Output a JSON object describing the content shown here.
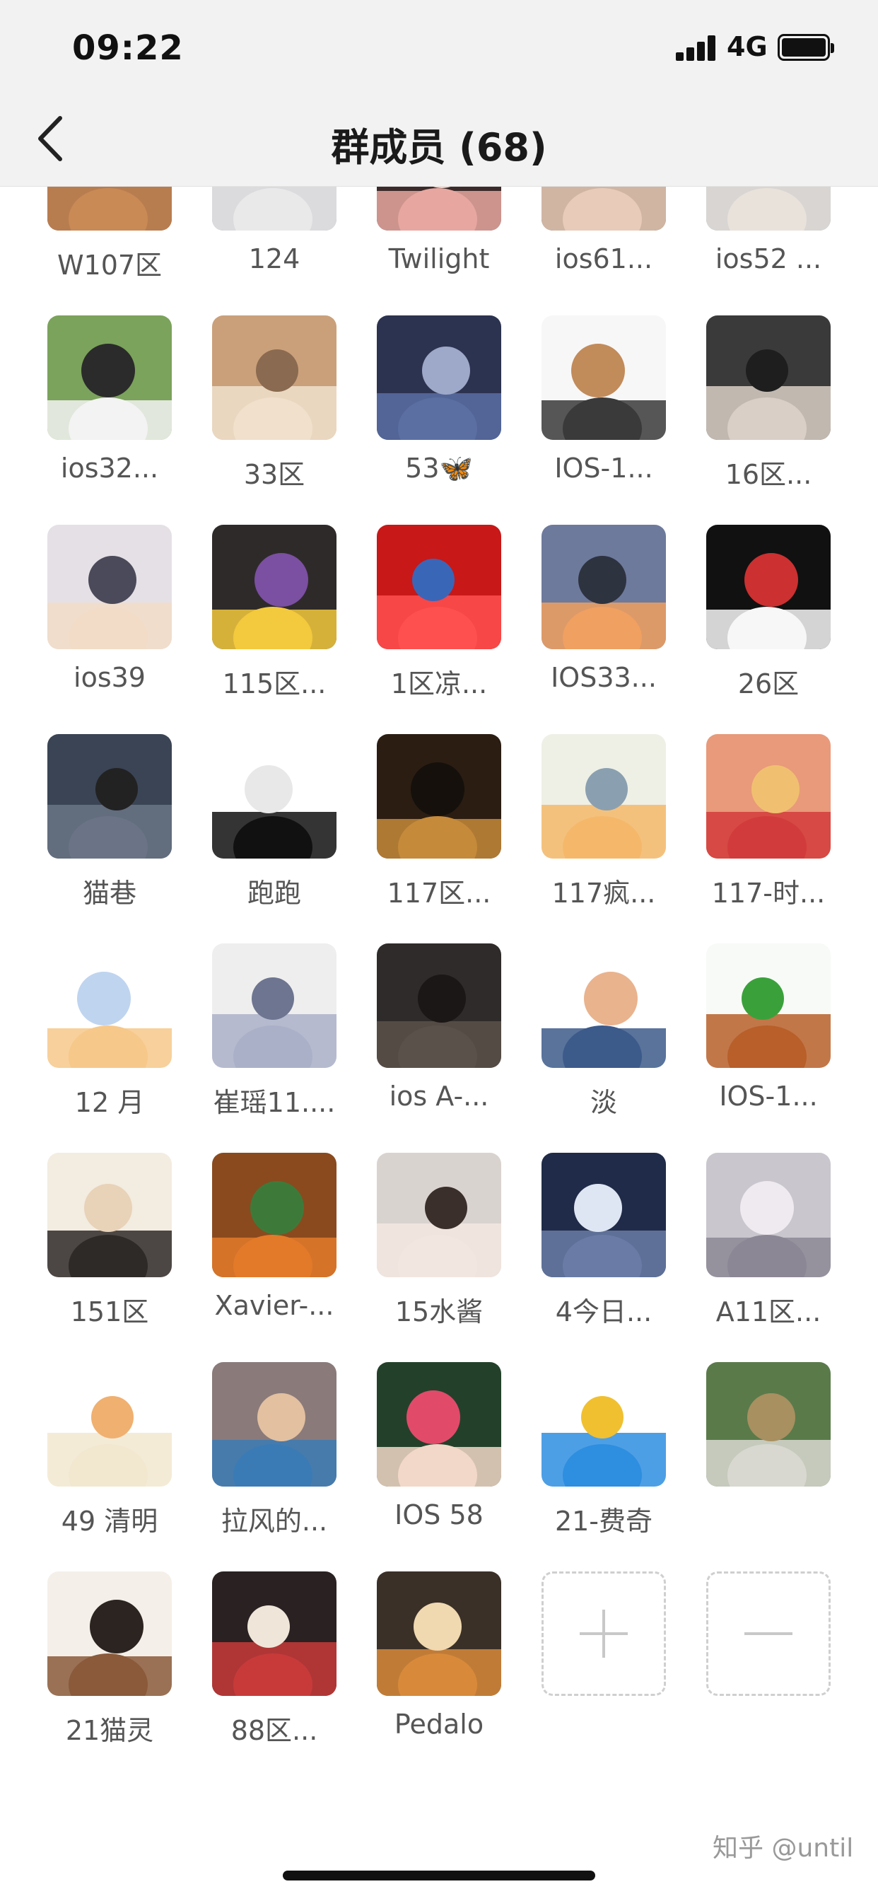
{
  "status_bar": {
    "time": "09:22",
    "network": "4G"
  },
  "header": {
    "title": "群成员 (68)"
  },
  "members": [
    {
      "name": "W107区",
      "icon": "avatar-corridor-icon"
    },
    {
      "name": "124",
      "icon": "avatar-mountain-person-icon"
    },
    {
      "name": "Twilight",
      "icon": "avatar-child-face-icon"
    },
    {
      "name": "ios61...",
      "icon": "avatar-girl-smile-icon"
    },
    {
      "name": "ios52 ...",
      "icon": "avatar-man-railing-icon"
    },
    {
      "name": "ios32...",
      "icon": "avatar-man-dog-icon"
    },
    {
      "name": "33区",
      "icon": "avatar-cat-blanket-icon"
    },
    {
      "name": "53🦋",
      "icon": "avatar-anime-character-icon"
    },
    {
      "name": "IOS-1...",
      "icon": "avatar-lion-warrior-icon"
    },
    {
      "name": "16区...",
      "icon": "avatar-man-closeup-icon"
    },
    {
      "name": "ios39",
      "icon": "avatar-anime-boy-icon"
    },
    {
      "name": "115区...",
      "icon": "avatar-basketball-players-icon"
    },
    {
      "name": "1区凉...",
      "icon": "avatar-newyear-red-icon"
    },
    {
      "name": "IOS33...",
      "icon": "avatar-sunset-icon"
    },
    {
      "name": "26区",
      "icon": "avatar-family-bicycle-icon"
    },
    {
      "name": "猫巷",
      "icon": "avatar-child-bowl-icon"
    },
    {
      "name": "跑跑",
      "icon": "avatar-manga-boy-icon"
    },
    {
      "name": "117区...",
      "icon": "avatar-night-street-icon"
    },
    {
      "name": "117疯...",
      "icon": "avatar-cartoon-cat-icon"
    },
    {
      "name": "117-时...",
      "icon": "avatar-boy-cat-drawing-icon"
    },
    {
      "name": "12 月",
      "icon": "avatar-chibi-kid-icon"
    },
    {
      "name": "崔瑶11....",
      "icon": "avatar-sketch-face-icon"
    },
    {
      "name": "ios A-...",
      "icon": "avatar-dark-anime-icon"
    },
    {
      "name": "淡",
      "icon": "avatar-cartoon-dad-kid-icon"
    },
    {
      "name": "IOS-1...",
      "icon": "avatar-boy-flower-icon"
    },
    {
      "name": "151区",
      "icon": "avatar-glasses-boy-icon"
    },
    {
      "name": "Xavier-...",
      "icon": "avatar-fox-icon"
    },
    {
      "name": "15水酱",
      "icon": "avatar-girl-cat-icon"
    },
    {
      "name": "4今日...",
      "icon": "avatar-night-coast-icon"
    },
    {
      "name": "A11区...",
      "icon": "avatar-anime-girl-book-icon"
    },
    {
      "name": "49 清明",
      "icon": "avatar-duck-sticker-icon"
    },
    {
      "name": "拉风的...",
      "icon": "avatar-toddler-icon"
    },
    {
      "name": "IOS  58",
      "icon": "avatar-boy-blush-icon"
    },
    {
      "name": "21-费奇",
      "icon": "avatar-doraemon-icon"
    },
    {
      "name": "",
      "icon": "avatar-car-child-icon"
    },
    {
      "name": "21猫灵",
      "icon": "avatar-girl-sweater-icon"
    },
    {
      "name": "88区...",
      "icon": "avatar-red-shirt-icon"
    },
    {
      "name": "Pedalo",
      "icon": "avatar-redhead-boy-icon"
    }
  ],
  "actions": {
    "add_icon": "plus-icon",
    "remove_icon": "minus-icon"
  },
  "watermark": "知乎 @until",
  "colors": {
    "bar_bg": "#f2f2f2",
    "name_text": "#555555",
    "dashed_border": "#cfcfcf"
  }
}
